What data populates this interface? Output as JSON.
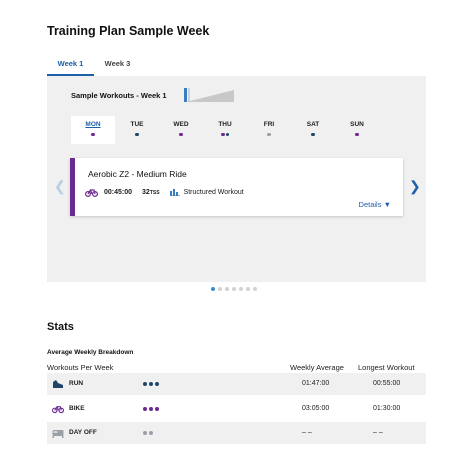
{
  "page_title": "Training Plan Sample Week",
  "tabs": [
    {
      "label": "Week 1",
      "active": true
    },
    {
      "label": "Week 3",
      "active": false
    }
  ],
  "sample": {
    "title": "Sample Workouts - Week 1",
    "days": [
      {
        "label": "MON",
        "active": true,
        "dots": [
          "#6b2a8f"
        ]
      },
      {
        "label": "TUE",
        "active": false,
        "dots": [
          "#1f4666"
        ]
      },
      {
        "label": "WED",
        "active": false,
        "dots": [
          "#6b2a8f"
        ]
      },
      {
        "label": "THU",
        "active": false,
        "dots": [
          "#6b2a8f",
          "#1f4666"
        ]
      },
      {
        "label": "FRI",
        "active": false,
        "dots": [
          "#9aa0a6"
        ]
      },
      {
        "label": "SAT",
        "active": false,
        "dots": [
          "#1f4666"
        ]
      },
      {
        "label": "SUN",
        "active": false,
        "dots": [
          "#6b2a8f"
        ]
      }
    ]
  },
  "workout": {
    "name": "Aerobic Z2 - Medium Ride",
    "duration": "00:45:00",
    "tss_value": "32",
    "tss_unit": "TSS",
    "type": "Structured Workout",
    "details_label": "Details",
    "icon": "bike-icon"
  },
  "pager": {
    "count": 7,
    "active": 0
  },
  "stats": {
    "title": "Stats",
    "subtitle": "Average Weekly Breakdown",
    "headers": {
      "workouts_per_week": "Workouts Per Week",
      "weekly_average": "Weekly Average",
      "longest_workout": "Longest Workout"
    },
    "rows": [
      {
        "name": "RUN",
        "icon": "run-shoe-icon",
        "dots": 3,
        "dot_color": "#1f4666",
        "weekly_average": "01:47:00",
        "longest": "00:55:00"
      },
      {
        "name": "BIKE",
        "icon": "bike-icon",
        "dots": 3,
        "dot_color": "#6b2a8f",
        "weekly_average": "03:05:00",
        "longest": "01:30:00"
      },
      {
        "name": "DAY OFF",
        "icon": "bed-icon",
        "dots": 2,
        "dot_color": "#9aa0a6",
        "weekly_average": "– –",
        "longest": "– –"
      }
    ]
  },
  "colors": {
    "accent": "#1d5fa8",
    "bike": "#6b2a8f",
    "run": "#1f4666",
    "rest": "#9aa0a6"
  }
}
